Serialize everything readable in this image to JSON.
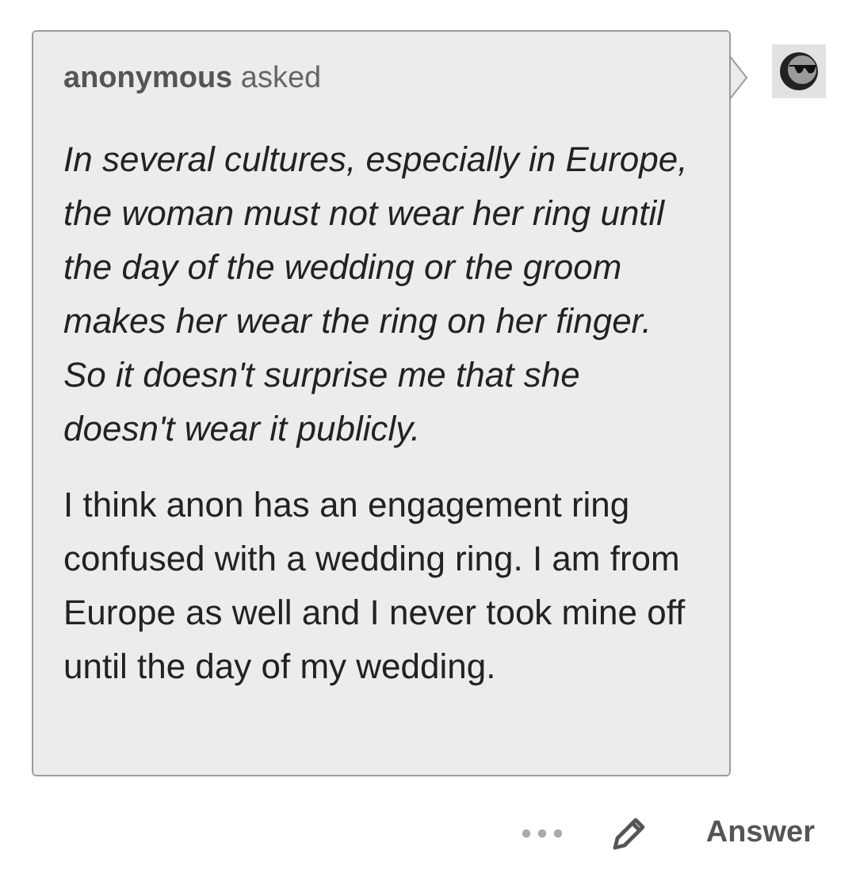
{
  "ask": {
    "header": "**anonymous** asked",
    "question": "In several cultures, especially in Europe, the woman must not wear her ring until the day of the wedding or the groom makes her wear the ring on her finger. So it doesn't surprise me that she doesn't wear it publicly.",
    "answer": "I think anon has an engagement ring confused with a wedding ring. I am from Europe as well and I never took mine off until the day of my wedding."
  },
  "actions": [
    {
      "kind": "more"
    },
    {
      "kind": "edit"
    },
    {
      "kind": "text",
      "label": "Answer"
    }
  ]
}
